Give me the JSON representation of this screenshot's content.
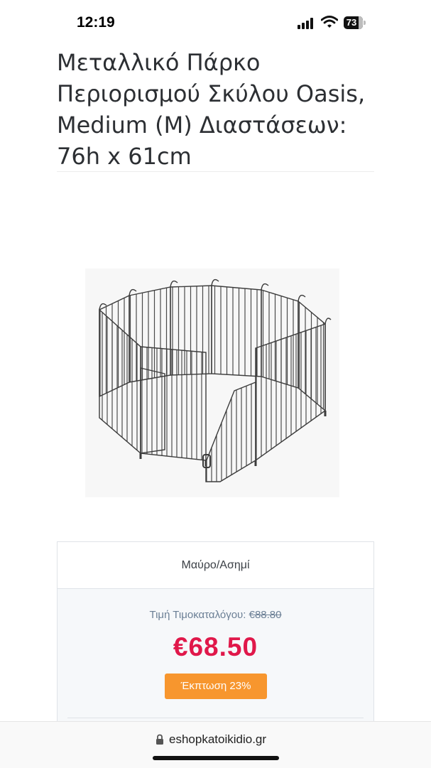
{
  "status_bar": {
    "time": "12:19",
    "battery_level": "73",
    "icons": [
      "cellular-signal-icon",
      "wifi-icon",
      "battery-icon"
    ]
  },
  "product": {
    "title": "Μεταλλικό Πάρκο Περιορισμού Σκύλου Oasis, Medium (M) Διαστάσεων: 76h x 61cm",
    "variant": "Μαύρο/Ασημί",
    "list_price_label": "Τιμή Τιμοκαταλόγου:",
    "list_price": "€88.80",
    "price": "€68.50",
    "discount_label": "Έκπτωση 23%",
    "colors": {
      "price": "#e0184a",
      "discount_badge": "#f7962e",
      "list_price_text": "#6b7f95"
    }
  },
  "browser": {
    "url": "eshopkatoikidio.gr",
    "icons": [
      "lock-icon"
    ]
  }
}
